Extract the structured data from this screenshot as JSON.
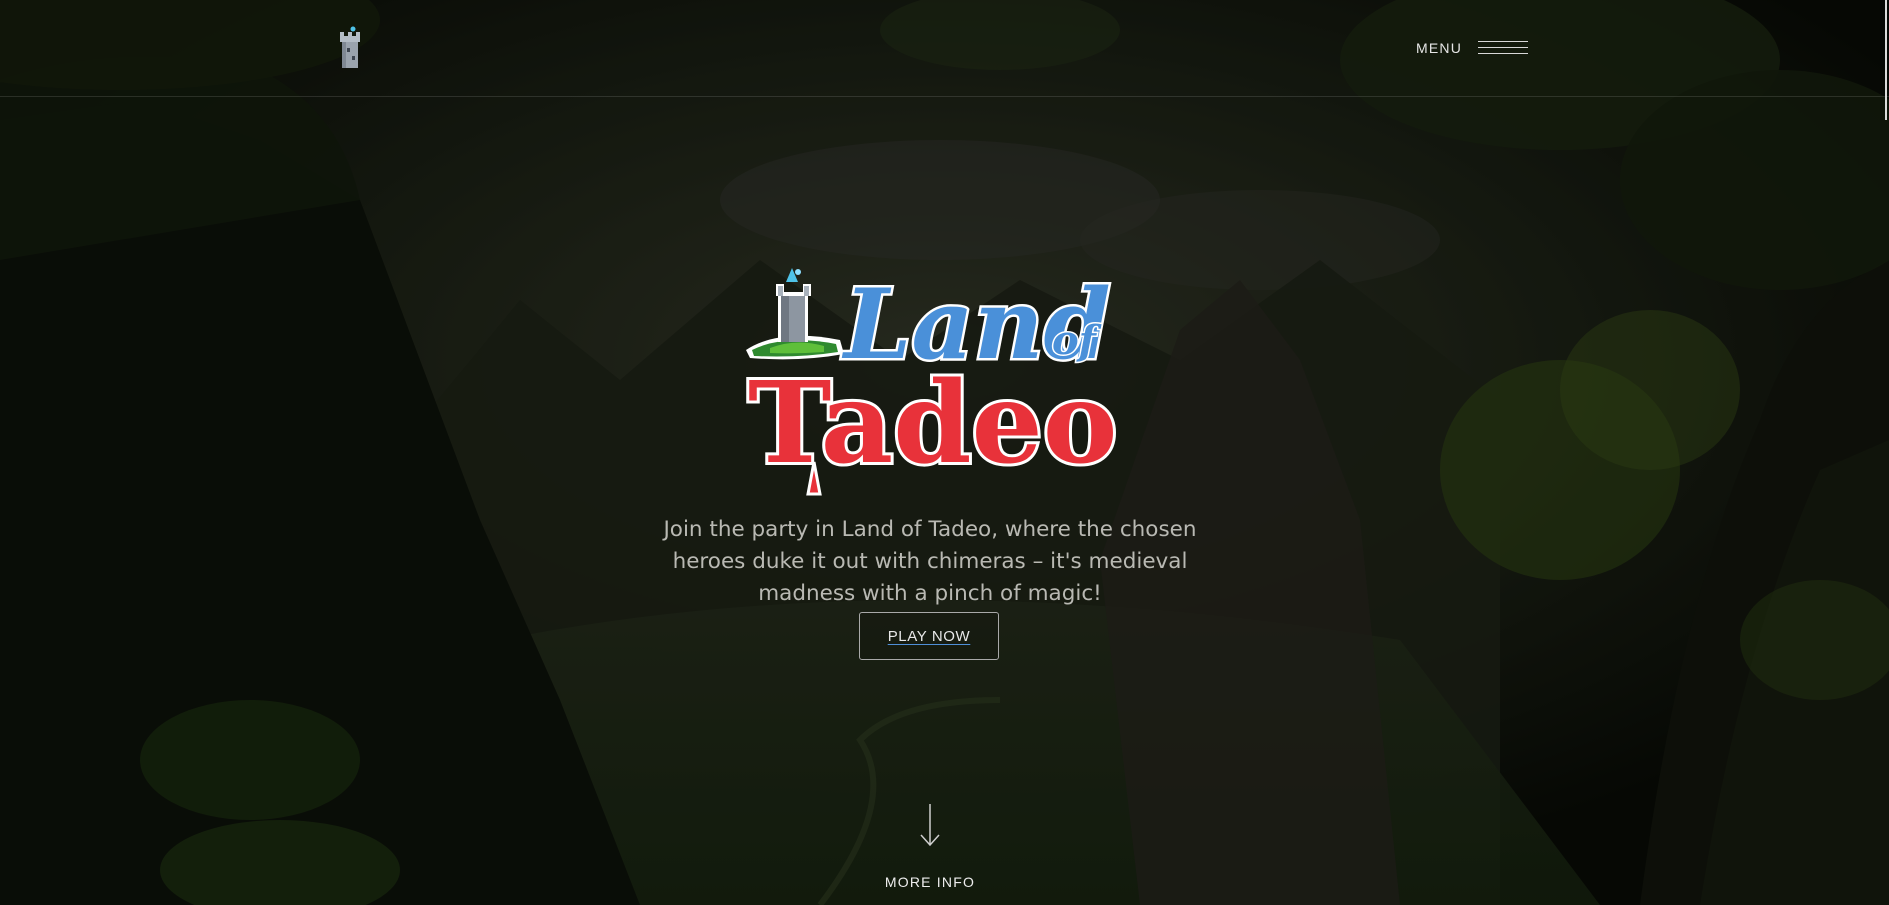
{
  "header": {
    "logo_icon": "tower-icon",
    "menu_label": "MENU",
    "menu_icon": "hamburger-icon"
  },
  "hero": {
    "logo_text_top": "Land",
    "logo_text_of": "of",
    "logo_text_bottom": "Tadeo",
    "logo_icon": "castle-island-icon",
    "tagline": "Join the party in Land of Tadeo, where the chosen heroes duke it out with chimeras – it's medieval madness with a pinch of magic!",
    "play_button_label": "PLAY NOW"
  },
  "footer_cue": {
    "icon": "arrow-down-icon",
    "label": "MORE INFO"
  },
  "colors": {
    "background": "#0d1109",
    "logo_blue": "#4a90d9",
    "logo_red": "#e8323a",
    "tagline": "#b9b9b3",
    "button_border": "#a9a9a9",
    "link_underline": "#4f8fd8"
  }
}
